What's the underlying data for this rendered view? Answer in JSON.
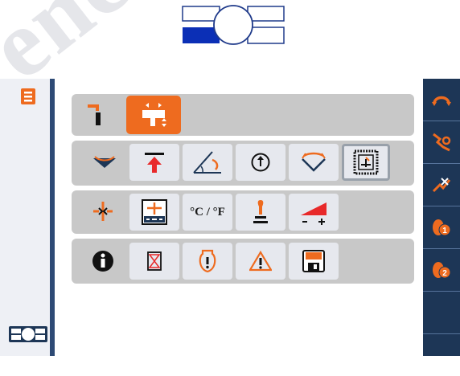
{
  "watermark": "ench",
  "header_logo": {
    "name": "machine-logo"
  },
  "rows": [
    {
      "name": "row-hydraulics",
      "cells": [
        "hitch-icon",
        "valve-control-icon"
      ]
    },
    {
      "name": "row-implement",
      "cells": [
        "lower-icon",
        "top-limit-icon",
        "angle-icon",
        "gauge-icon",
        "swing-icon",
        "sensor-icon"
      ]
    },
    {
      "name": "row-settings",
      "cells": [
        "pto-icon",
        "display-setup-icon",
        "temperature-unit",
        "joystick-icon",
        "volume-icon"
      ]
    },
    {
      "name": "row-info",
      "cells": [
        "info-icon",
        "timer-icon",
        "warning-engine-icon",
        "warning-icon",
        "software-version-icon"
      ]
    }
  ],
  "temperature_unit_label": "°C / °F",
  "right_buttons": [
    "rotate-icon",
    "tool-1-icon",
    "tool-2-icon",
    "reel-1-icon",
    "reel-2-icon",
    "empty-1",
    "empty-2"
  ],
  "colors": {
    "accent_orange": "#ee6b1f",
    "navy": "#1d3656",
    "row_gray": "#c8c8c8",
    "cell_bg": "#e6e8ee",
    "red": "#e8292a"
  }
}
